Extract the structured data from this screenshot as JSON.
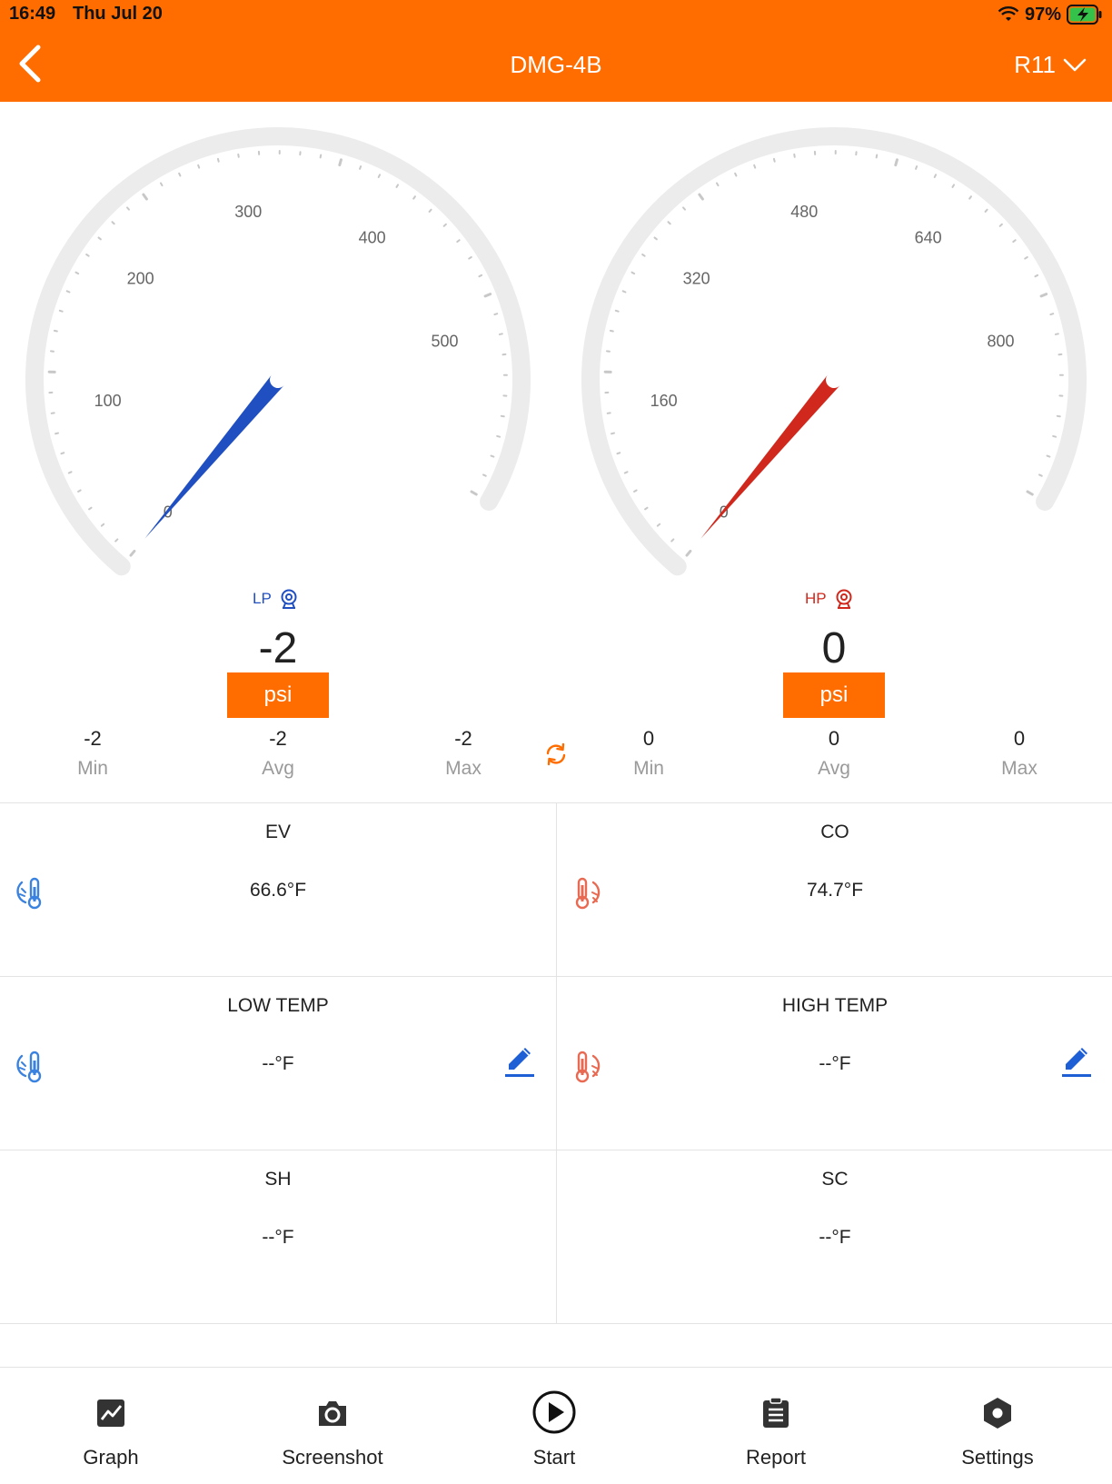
{
  "status": {
    "time": "16:49",
    "date": "Thu Jul 20",
    "battery": "97%"
  },
  "header": {
    "title": "DMG-4B",
    "refrigerant": "R11"
  },
  "gauges": {
    "lp": {
      "label": "LP",
      "value": "-2",
      "unit": "psi",
      "needle_value": -2,
      "scale_max": 600,
      "color": "#1f4fc1",
      "ticks": [
        "0",
        "100",
        "200",
        "300",
        "400",
        "500"
      ],
      "stats": {
        "min": "-2",
        "avg": "-2",
        "max": "-2",
        "min_label": "Min",
        "avg_label": "Avg",
        "max_label": "Max"
      }
    },
    "hp": {
      "label": "HP",
      "value": "0",
      "unit": "psi",
      "needle_value": 0,
      "scale_max": 960,
      "color": "#d0281c",
      "ticks": [
        "0",
        "160",
        "320",
        "480",
        "640",
        "800"
      ],
      "stats": {
        "min": "0",
        "avg": "0",
        "max": "0",
        "min_label": "Min",
        "avg_label": "Avg",
        "max_label": "Max"
      }
    }
  },
  "cells": {
    "ev": {
      "title": "EV",
      "value": "66.6°F"
    },
    "co": {
      "title": "CO",
      "value": "74.7°F"
    },
    "low_temp": {
      "title": "LOW TEMP",
      "value": "--°F"
    },
    "high_temp": {
      "title": "HIGH TEMP",
      "value": "--°F"
    },
    "sh": {
      "title": "SH",
      "value": "--°F"
    },
    "sc": {
      "title": "SC",
      "value": "--°F"
    }
  },
  "tabs": [
    {
      "label": "Graph",
      "icon": "graph-icon"
    },
    {
      "label": "Screenshot",
      "icon": "camera-icon"
    },
    {
      "label": "Start",
      "icon": "play-icon"
    },
    {
      "label": "Report",
      "icon": "clipboard-icon"
    },
    {
      "label": "Settings",
      "icon": "settings-hex-icon"
    }
  ],
  "colors": {
    "accent": "#ff6d00",
    "lp_blue": "#1f4fc1",
    "hp_red": "#d0281c"
  }
}
